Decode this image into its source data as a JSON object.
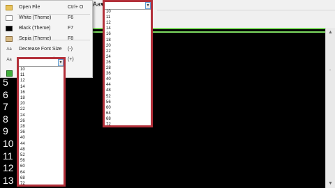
{
  "toolbar": {
    "font_button_label": "Aa"
  },
  "menu": {
    "items": [
      {
        "label": "Open File",
        "shortcut": "Ctrl+ O",
        "icon": "folder-icon"
      },
      {
        "label": "White (Theme)",
        "shortcut": "F6",
        "icon": "white-theme-icon"
      },
      {
        "label": "Black (Theme)",
        "shortcut": "F7",
        "icon": "black-theme-icon"
      },
      {
        "label": "Sepia (Theme)",
        "shortcut": "F8",
        "icon": "sepia-theme-icon"
      },
      {
        "label": "Decrease Font Size",
        "shortcut": "(-)",
        "icon": "decrease-font-icon"
      },
      {
        "label": "Increase Font Size",
        "shortcut": "(+)",
        "icon": "increase-font-icon"
      }
    ]
  },
  "line_numbers": [
    "5",
    "6",
    "7",
    "8",
    "9",
    "10",
    "11",
    "12",
    "13"
  ],
  "font_sizes_left": [
    "10",
    "11",
    "12",
    "14",
    "16",
    "18",
    "20",
    "22",
    "24",
    "26",
    "28",
    "36",
    "40",
    "44",
    "48",
    "52",
    "56",
    "60",
    "64",
    "68",
    "72"
  ],
  "font_sizes_right": [
    "10",
    "11",
    "12",
    "14",
    "16",
    "18",
    "20",
    "22",
    "24",
    "26",
    "28",
    "36",
    "40",
    "44",
    "48",
    "52",
    "56",
    "60",
    "64",
    "68",
    "72"
  ],
  "colors": {
    "highlight_border": "#b3303a",
    "accent_green": "#7edc61",
    "editor_bg": "#000000"
  }
}
